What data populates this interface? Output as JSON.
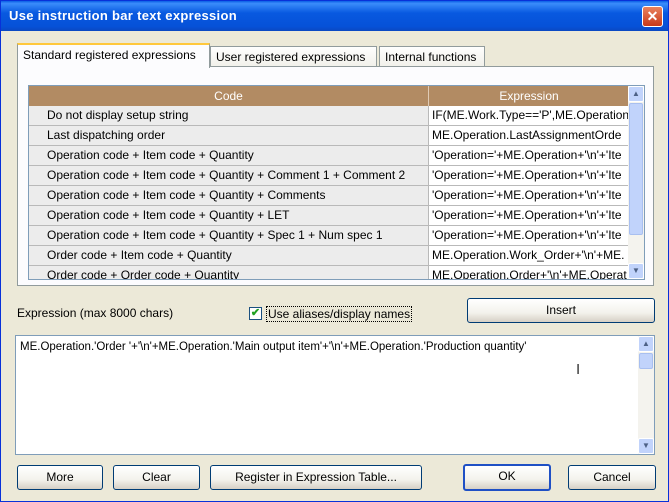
{
  "window": {
    "title": "Use instruction bar text expression",
    "close_symbol": "✕"
  },
  "tabs": [
    {
      "label": "Standard registered expressions"
    },
    {
      "label": "User registered expressions"
    },
    {
      "label": "Internal functions"
    }
  ],
  "grid": {
    "header_code": "Code",
    "header_expression": "Expression",
    "rows": [
      {
        "code": "Do not display setup string",
        "expression": "IF(ME.Work.Type=='P',ME.Operation"
      },
      {
        "code": "Last dispatching order",
        "expression": "ME.Operation.LastAssignmentOrde"
      },
      {
        "code": "Operation code + Item code + Quantity",
        "expression": "'Operation='+ME.Operation+'\\n'+'Ite"
      },
      {
        "code": "Operation code + Item code + Quantity + Comment 1 + Comment 2",
        "expression": "'Operation='+ME.Operation+'\\n'+'Ite"
      },
      {
        "code": "Operation code + Item code + Quantity + Comments",
        "expression": "'Operation='+ME.Operation+'\\n'+'Ite"
      },
      {
        "code": "Operation code + Item code + Quantity + LET",
        "expression": "'Operation='+ME.Operation+'\\n'+'Ite"
      },
      {
        "code": "Operation code + Item code + Quantity + Spec 1 + Num spec 1",
        "expression": "'Operation='+ME.Operation+'\\n'+'Ite"
      },
      {
        "code": "Order code + Item code + Quantity",
        "expression": "ME.Operation.Work_Order+'\\n'+ME."
      },
      {
        "code": "Order code + Order code + Quantity",
        "expression": "ME.Operation.Order+'\\n'+ME.Operat"
      }
    ]
  },
  "expression_label": "Expression (max 8000 chars)",
  "use_aliases": {
    "label": "Use aliases/display names",
    "checked": true
  },
  "expression_text": "ME.Operation.'Order '+'\\n'+ME.Operation.'Main output item'+'\\n'+ME.Operation.'Production quantity'",
  "buttons": {
    "insert": "Insert",
    "more": "More",
    "clear": "Clear",
    "register": "Register in Expression Table...",
    "ok": "OK",
    "cancel": "Cancel"
  }
}
